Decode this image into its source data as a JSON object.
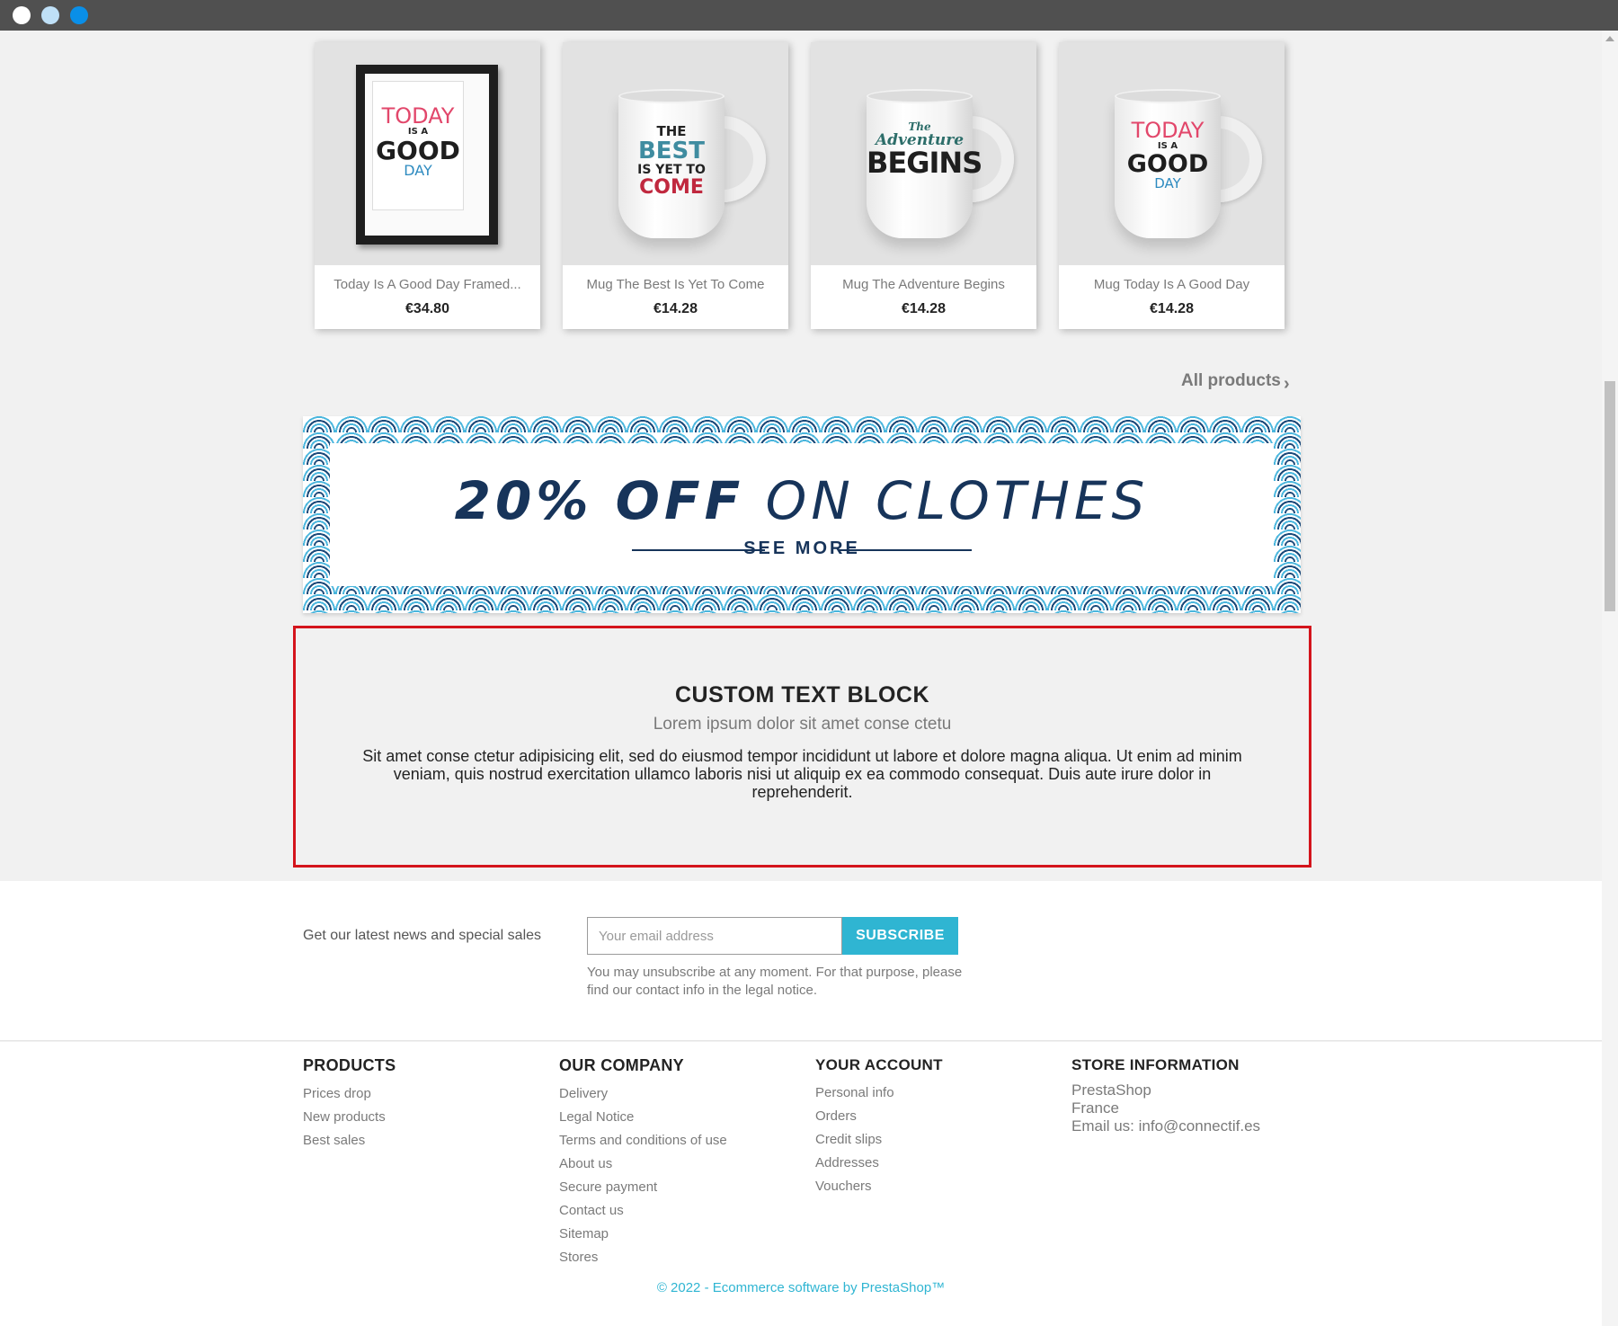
{
  "products": [
    {
      "name": "Today Is A Good Day Framed...",
      "price": "€34.80",
      "art": [
        "TODAY",
        "IS A",
        "GOOD",
        "DAY"
      ]
    },
    {
      "name": "Mug The Best Is Yet To Come",
      "price": "€14.28",
      "art": [
        "THE",
        "BEST",
        "IS YET TO",
        "COME"
      ]
    },
    {
      "name": "Mug The Adventure Begins",
      "price": "€14.28",
      "art": [
        "The",
        "Adventure",
        "BEGINS"
      ]
    },
    {
      "name": "Mug Today Is A Good Day",
      "price": "€14.28",
      "art": [
        "TODAY",
        "IS A",
        "GOOD",
        "DAY"
      ]
    }
  ],
  "all_products_label": "All products",
  "banner": {
    "bold": "20% OFF",
    "light": "ON CLOTHES",
    "cta": "SEE MORE"
  },
  "custom_block": {
    "title": "CUSTOM TEXT BLOCK",
    "subtitle": "Lorem ipsum dolor sit amet conse ctetu",
    "body": "Sit amet conse ctetur adipisicing elit, sed do eiusmod tempor incididunt ut labore et dolore magna aliqua. Ut enim ad minim veniam, quis nostrud exercitation ullamco laboris nisi ut aliquip ex ea commodo consequat. Duis aute irure dolor in reprehenderit."
  },
  "newsletter": {
    "label": "Get our latest news and special sales",
    "placeholder": "Your email address",
    "button": "SUBSCRIBE",
    "note": "You may unsubscribe at any moment. For that purpose, please find our contact info in the legal notice."
  },
  "footer": {
    "products": {
      "title": "PRODUCTS",
      "links": [
        "Prices drop",
        "New products",
        "Best sales"
      ]
    },
    "company": {
      "title": "OUR COMPANY",
      "links": [
        "Delivery",
        "Legal Notice",
        "Terms and conditions of use",
        "About us",
        "Secure payment",
        "Contact us",
        "Sitemap",
        "Stores"
      ]
    },
    "account": {
      "title": "YOUR ACCOUNT",
      "links": [
        "Personal info",
        "Orders",
        "Credit slips",
        "Addresses",
        "Vouchers"
      ]
    },
    "store": {
      "title": "STORE INFORMATION",
      "lines": [
        "PrestaShop",
        "France",
        "Email us: info@connectif.es"
      ]
    },
    "copyright": "© 2022 - Ecommerce software by PrestaShop™"
  },
  "colors": {
    "accent": "#2fb5d2",
    "banner_navy": "#17345a",
    "highlight_border": "#d4141c"
  }
}
